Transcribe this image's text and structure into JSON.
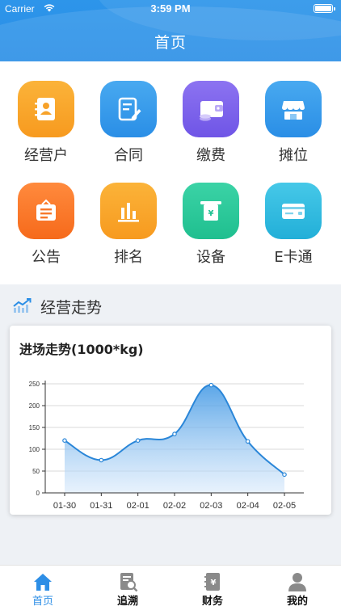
{
  "status": {
    "carrier": "Carrier",
    "time": "3:59 PM"
  },
  "nav": {
    "title": "首页"
  },
  "grid": [
    {
      "label": "经营户",
      "icon": "contact-book-icon",
      "color_top": "#fbb339",
      "color_bottom": "#f79a1f"
    },
    {
      "label": "合同",
      "icon": "contract-edit-icon",
      "color_top": "#48a9f0",
      "color_bottom": "#2a8ee6"
    },
    {
      "label": "缴费",
      "icon": "wallet-coins-icon",
      "color_top": "#8c73f1",
      "color_bottom": "#6f55e6"
    },
    {
      "label": "摊位",
      "icon": "storefront-icon",
      "color_top": "#48a9f0",
      "color_bottom": "#2a8ee6"
    },
    {
      "label": "公告",
      "icon": "notice-board-icon",
      "color_top": "#ff8a3d",
      "color_bottom": "#f66a1b"
    },
    {
      "label": "排名",
      "icon": "bar-ranking-icon",
      "color_top": "#fbb339",
      "color_bottom": "#f79a1f"
    },
    {
      "label": "设备",
      "icon": "yuan-terminal-icon",
      "color_top": "#3bd3a6",
      "color_bottom": "#1fbf8f"
    },
    {
      "label": "E卡通",
      "icon": "card-icon",
      "color_top": "#46c8e8",
      "color_bottom": "#22afd8"
    }
  ],
  "section": {
    "title": "经营走势",
    "icon": "trend-chart-icon"
  },
  "chart_data": {
    "type": "area",
    "title": "进场走势(1000*kg)",
    "categories": [
      "01-30",
      "01-31",
      "02-01",
      "02-02",
      "02-03",
      "02-04",
      "02-05"
    ],
    "values": [
      120,
      75,
      120,
      135,
      247,
      118,
      42
    ],
    "ylim": [
      0,
      250
    ],
    "yticks": [
      0,
      50,
      100,
      150,
      200,
      250
    ],
    "grid": true,
    "line_color": "#2a86d8"
  },
  "tabs": [
    {
      "label": "首页",
      "icon": "home-icon",
      "active": true
    },
    {
      "label": "追溯",
      "icon": "trace-doc-icon",
      "active": false
    },
    {
      "label": "财务",
      "icon": "finance-ledger-icon",
      "active": false
    },
    {
      "label": "我的",
      "icon": "user-icon",
      "active": false
    }
  ]
}
